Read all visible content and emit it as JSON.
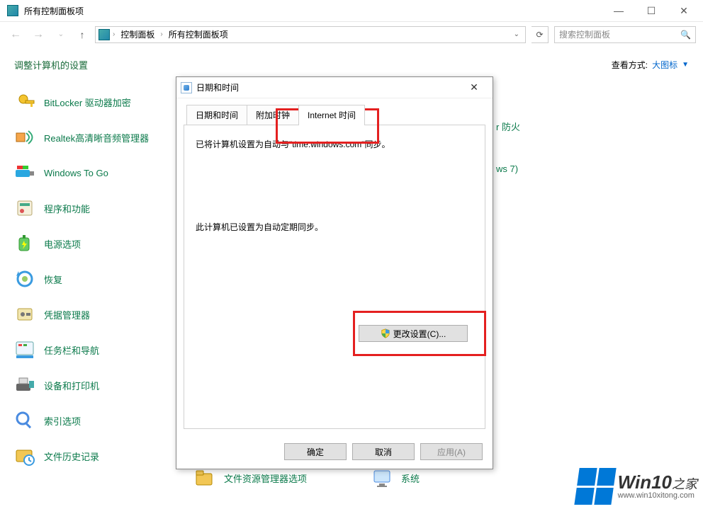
{
  "window": {
    "title": "所有控制面板项"
  },
  "window_buttons": {
    "min": "—",
    "max": "☐",
    "close": "✕"
  },
  "nav": {
    "crumb1": "控制面板",
    "crumb2": "所有控制面板项"
  },
  "search": {
    "placeholder": "搜索控制面板"
  },
  "header": {
    "heading": "调整计算机的设置",
    "view_label": "查看方式:",
    "view_value": "大图标"
  },
  "items": [
    {
      "label": "BitLocker 驱动器加密"
    },
    {
      "label": "Realtek高清晰音频管理器"
    },
    {
      "label": "Windows To Go"
    },
    {
      "label": "程序和功能"
    },
    {
      "label": "电源选项"
    },
    {
      "label": "恢复"
    },
    {
      "label": "凭据管理器"
    },
    {
      "label": "任务栏和导航"
    },
    {
      "label": "设备和打印机"
    },
    {
      "label": "索引选项"
    },
    {
      "label": "文件历史记录"
    },
    {
      "label": "文件资源管理器选项"
    },
    {
      "label": "系统"
    }
  ],
  "partial_items": {
    "right1": "r 防火",
    "right2": "ws 7)"
  },
  "dialog": {
    "title": "日期和时间",
    "tabs": {
      "t1": "日期和时间",
      "t2": "附加时钟",
      "t3": "Internet 时间"
    },
    "message1": "已将计算机设置为自动与\"time.windows.com\"同步。",
    "message2": "此计算机已设置为自动定期同步。",
    "change_btn": "更改设置(C)...",
    "ok": "确定",
    "cancel": "取消",
    "apply": "应用(A)"
  },
  "watermark": {
    "text": "Win10",
    "suffix": "之家",
    "url": "www.win10xitong.com"
  }
}
